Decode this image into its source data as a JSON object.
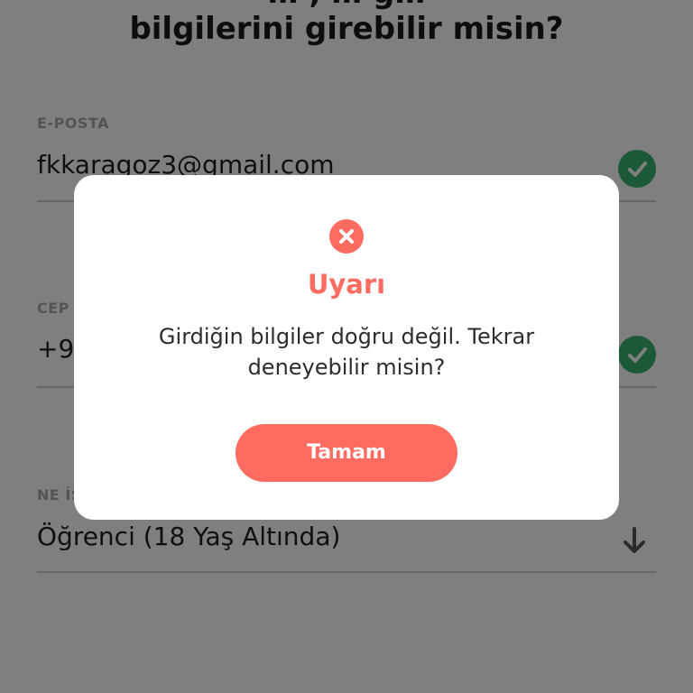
{
  "page_title": {
    "line1": "… , … g…",
    "line2": "bilgilerini girebilir misin?"
  },
  "fields": {
    "email": {
      "label": "E-POSTA",
      "value": "fkkaragoz3@gmail.com",
      "status_icon": "check-circle-icon"
    },
    "phone": {
      "label": "CEP",
      "value": "+9",
      "status_icon": "check-circle-icon"
    },
    "occupation": {
      "label": "NE İŞ",
      "value": "Öğrenci (18 Yaş Altında)",
      "dropdown_icon": "arrow-down-icon"
    }
  },
  "dialog": {
    "icon": "error-circle-icon",
    "title": "Uyarı",
    "message": "Girdiğin bilgiler doğru değil. Tekrar deneyebilir misin?",
    "button_label": "Tamam"
  },
  "colors": {
    "accent": "#fe6b61",
    "success": "#36b373",
    "overlay": "rgba(0,0,0,0.5)"
  }
}
